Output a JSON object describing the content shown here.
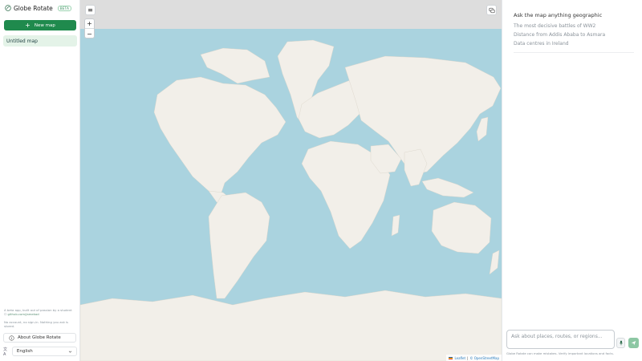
{
  "sidebar": {
    "brand_name": "Globe Rotate",
    "badge": "BETA",
    "new_map_label": "New map",
    "maps": [
      {
        "title": "Untitled map"
      }
    ],
    "footer_note_1": "A beta app, built out of passion by a student",
    "footer_link": "github.com/jamekad",
    "footer_note_2": "No account, no sign-in. Nothing you ask is stored.",
    "about_label": "About Globe Rotate",
    "language": "English"
  },
  "map": {
    "zoom_in_label": "+",
    "zoom_out_label": "−",
    "attribution_leaflet": "Leaflet",
    "attribution_sep": "|",
    "attribution_osm": "© OpenStreetMap",
    "land_color": "#f2efe9",
    "water_color": "#aad3df"
  },
  "chat": {
    "heading": "Ask the map anything geographic",
    "suggestions": [
      "The most decisive battles of WW2",
      "Distance from Addis Ababa to Asmara",
      "Data centres in Ireland"
    ],
    "input_placeholder": "Ask about places, routes, or regions...",
    "disclaimer": "Globe Rotate can make mistakes. Verify important locations and facts.",
    "accent_color": "#1f8a4d"
  }
}
